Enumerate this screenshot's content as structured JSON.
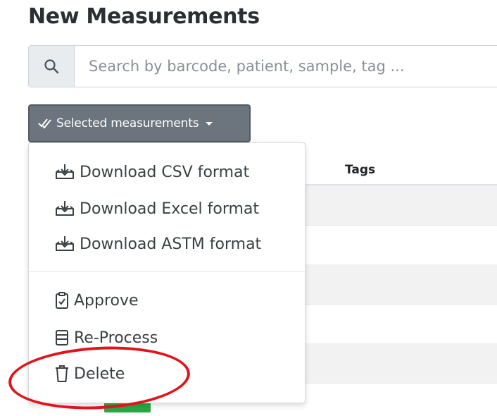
{
  "page": {
    "title": "New Measurements"
  },
  "search": {
    "placeholder": "Search by barcode, patient, sample, tag ...",
    "icon": "search-icon"
  },
  "toolbar": {
    "selected_label": "Selected measurements",
    "icon": "check-double-icon"
  },
  "table": {
    "headers": [
      "Tags"
    ]
  },
  "dropdown": {
    "items": [
      {
        "label": "Download CSV format",
        "icon": "download-icon"
      },
      {
        "label": "Download Excel format",
        "icon": "download-icon"
      },
      {
        "label": "Download ASTM format",
        "icon": "download-icon"
      },
      {
        "label": "Approve",
        "icon": "clipboard-check-icon"
      },
      {
        "label": "Re-Process",
        "icon": "reprocess-icon"
      },
      {
        "label": "Delete",
        "icon": "trash-icon"
      }
    ]
  },
  "colors": {
    "annotation": "#e0141a",
    "button_bg": "#6c757d",
    "badge": "#28a745"
  }
}
